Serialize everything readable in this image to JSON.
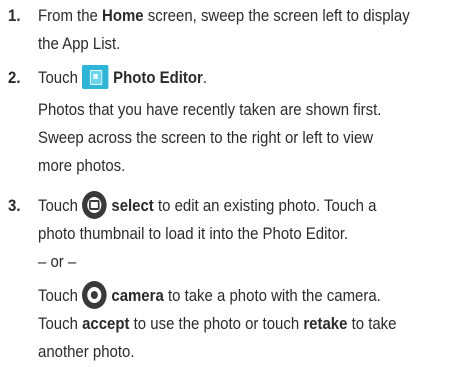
{
  "steps": [
    {
      "number": "1.",
      "line1_pre": "From the ",
      "line1_bold": "Home",
      "line1_post": " screen, sweep the screen left to display",
      "line2": "the App List."
    },
    {
      "number": "2.",
      "touch": "Touch",
      "app_label": "Photo Editor",
      "app_punct": ".",
      "para1": "Photos that you have recently taken are shown first.",
      "para2": "Sweep across the screen to the right or left to view",
      "para3": "more photos."
    },
    {
      "number": "3.",
      "touch": "Touch",
      "select_label": "select",
      "select_rest": " to edit an existing photo. Touch a",
      "select_line2": "photo thumbnail to load it into the Photo Editor.",
      "or_text": "– or –",
      "touch2": "Touch",
      "camera_label": "camera",
      "camera_rest": " to take a photo with the camera.",
      "accept_pre": "Touch ",
      "accept_label": "accept",
      "accept_mid": " to use the photo or touch ",
      "retake_label": "retake",
      "accept_post": " to take",
      "final_line": "another photo."
    }
  ],
  "icons": {
    "app_icon": "photo-editor-app-icon",
    "select_icon": "select-icon",
    "camera_icon": "camera-icon"
  }
}
